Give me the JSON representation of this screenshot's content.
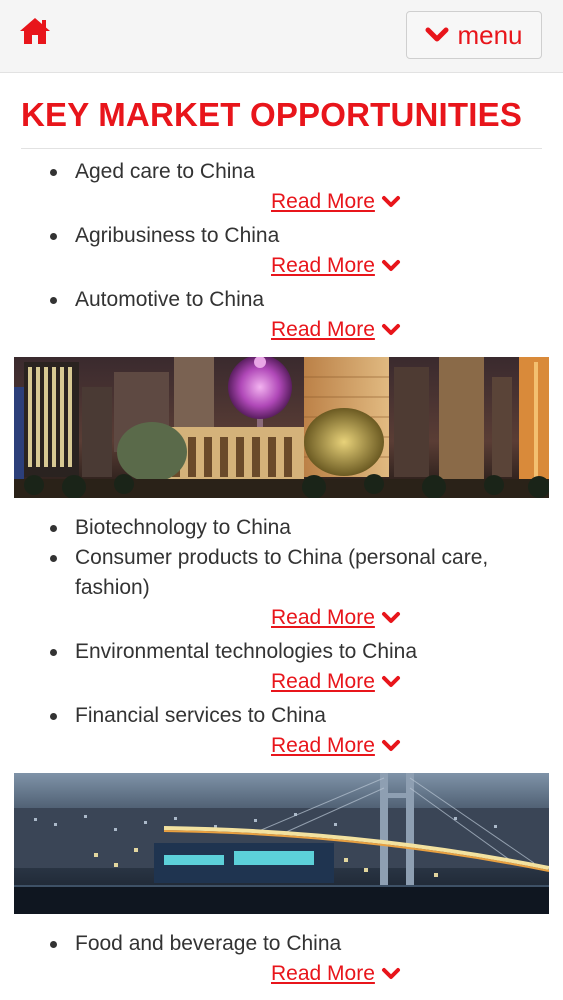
{
  "header": {
    "home_icon": "home-icon",
    "menu_icon": "chevron-down-icon",
    "menu_label": "menu",
    "accent_color": "#e8151b"
  },
  "main": {
    "title": "KEY MARKET OPPORTUNITIES",
    "read_more_label": "Read More",
    "items": [
      {
        "label": "Aged care to China"
      },
      {
        "label": "Agribusiness to China"
      },
      {
        "label": "Automotive to China"
      },
      {
        "label": "Biotechnology to China"
      },
      {
        "label": "Consumer products to China (personal care, fashion)"
      },
      {
        "label": "Environmental technologies to China"
      },
      {
        "label": "Financial services to China"
      },
      {
        "label": "Food and beverage to China"
      }
    ]
  }
}
